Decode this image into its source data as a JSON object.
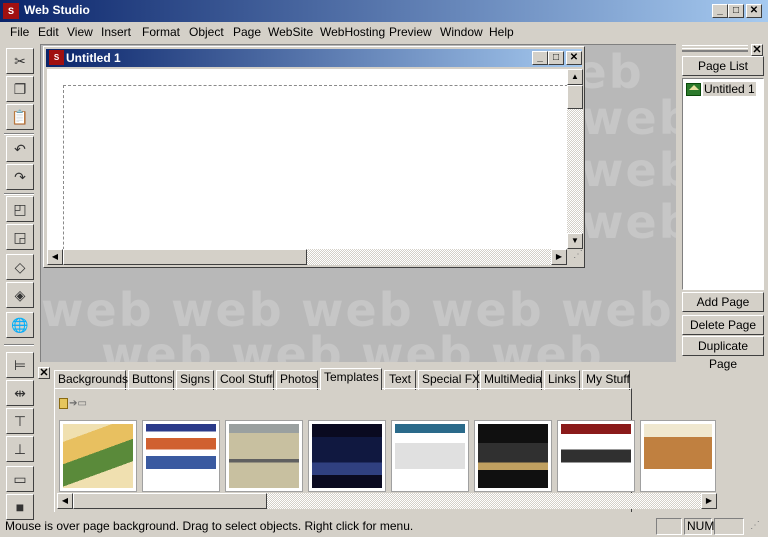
{
  "app": {
    "title": "Web Studio",
    "icon_text": "S"
  },
  "window_controls": {
    "minimize": "_",
    "maximize": "□",
    "close": "✕"
  },
  "menu": [
    "File",
    "Edit",
    "View",
    "Insert",
    "Format",
    "Object",
    "Page",
    "WebSite",
    "WebHosting",
    "Preview",
    "Window",
    "Help"
  ],
  "left_toolbar": {
    "tools": [
      "scissors-icon",
      "copy-icon",
      "paste-icon",
      "undo-icon",
      "redo-icon",
      "bring-forward-icon",
      "send-backward-icon",
      "group-icon",
      "ungroup-icon",
      "globe-icon",
      "align-left-icon",
      "align-center-icon",
      "align-top-icon",
      "align-middle-icon",
      "size-icon",
      "fill-icon"
    ]
  },
  "workspace": {
    "watermark_text": "web"
  },
  "document": {
    "title": "Untitled 1",
    "icon_text": "S"
  },
  "page_panel": {
    "header": "Page List",
    "pages": [
      "Untitled 1"
    ],
    "add_button": "Add Page",
    "delete_button": "Delete Page",
    "duplicate_button": "Duplicate Page"
  },
  "gallery": {
    "tabs": [
      "Backgrounds",
      "Buttons",
      "Signs",
      "Cool Stuff",
      "Photos",
      "Templates",
      "Text",
      "Special FX",
      "MultiMedia",
      "Links",
      "My Stuff"
    ],
    "active_tab": "Templates",
    "thumbnails": [
      {
        "name": "template-1",
        "colors": [
          "#e8c060",
          "#5a8a3a",
          "#f0e0b0"
        ]
      },
      {
        "name": "template-2",
        "colors": [
          "#2a3a8a",
          "#d06030",
          "#ffffff"
        ]
      },
      {
        "name": "template-3",
        "colors": [
          "#9aa0a0",
          "#c8c0a0",
          "#606060"
        ]
      },
      {
        "name": "template-4",
        "colors": [
          "#101840",
          "#304080",
          "#0a0a20"
        ]
      },
      {
        "name": "template-5",
        "colors": [
          "#ffffff",
          "#2a6a8a",
          "#e0e0e0"
        ]
      },
      {
        "name": "template-6",
        "colors": [
          "#101010",
          "#303030",
          "#c0a060"
        ]
      },
      {
        "name": "template-7",
        "colors": [
          "#8a1a1a",
          "#ffffff",
          "#303030"
        ]
      },
      {
        "name": "template-8",
        "colors": [
          "#f0e8d0",
          "#c08040",
          "#ffffff"
        ]
      }
    ]
  },
  "status": {
    "text": "Mouse is over page background. Drag to select objects. Right click for menu.",
    "num": "NUM"
  }
}
